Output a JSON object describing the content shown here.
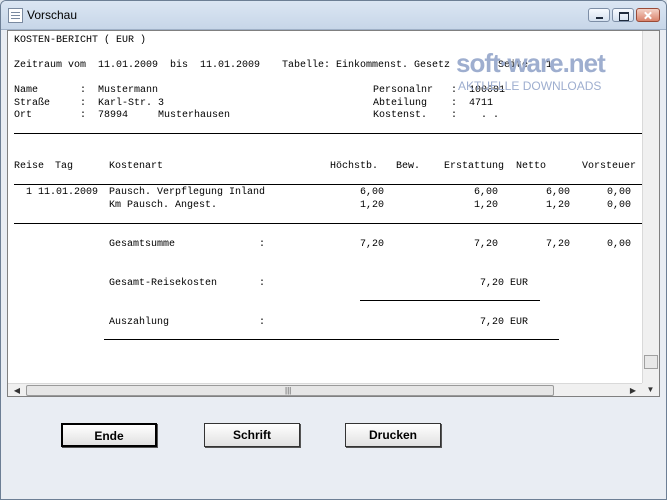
{
  "window": {
    "title": "Vorschau"
  },
  "watermark": {
    "main": "soft·ware.net",
    "sub": "AKTUELLE DOWNLOADS"
  },
  "report": {
    "heading": "KOSTEN-BERICHT ( EUR )",
    "period": "Zeitraum vom  11.01.2009  bis  11.01.2009",
    "table": "Tabelle: Einkommenst. Gesetz",
    "page": "Seite : 1",
    "person": {
      "name_label": "Name",
      "name_value": "Mustermann",
      "street_label": "Straße",
      "street_value": "Karl-Str. 3",
      "city_label": "Ort",
      "zip_value": "78994",
      "city_value": "Musterhausen",
      "persnr_label": "Personalnr",
      "persnr_value": "100001",
      "dept_label": "Abteilung",
      "dept_value": "4711",
      "cost_label": "Kostenst.",
      "cost_value": ". ."
    },
    "columns": [
      "Reise",
      "Tag",
      "Kostenart",
      "Höchstb.",
      "Bew.",
      "Erstattung",
      "Netto",
      "Vorsteuer"
    ],
    "rows": [
      {
        "trip": "1",
        "date": "11.01.2009",
        "type": "Pausch. Verpflegung Inland",
        "max": "6,00",
        "refund": "6,00",
        "net": "6,00",
        "vat": "0,00"
      },
      {
        "trip": "",
        "date": "",
        "type": "Km Pausch. Angest.",
        "max": "1,20",
        "refund": "1,20",
        "net": "1,20",
        "vat": "0,00"
      }
    ],
    "totals": {
      "sum_label": "Gesamtsumme",
      "sum_max": "7,20",
      "sum_refund": "7,20",
      "sum_net": "7,20",
      "sum_vat": "0,00",
      "trip_label": "Gesamt-Reisekosten",
      "trip_value": "7,20 EUR",
      "payout_label": "Auszahlung",
      "payout_value": "7,20 EUR"
    },
    "colon": ":"
  },
  "buttons": {
    "ende": "Ende",
    "schrift": "Schrift",
    "drucken": "Drucken"
  }
}
